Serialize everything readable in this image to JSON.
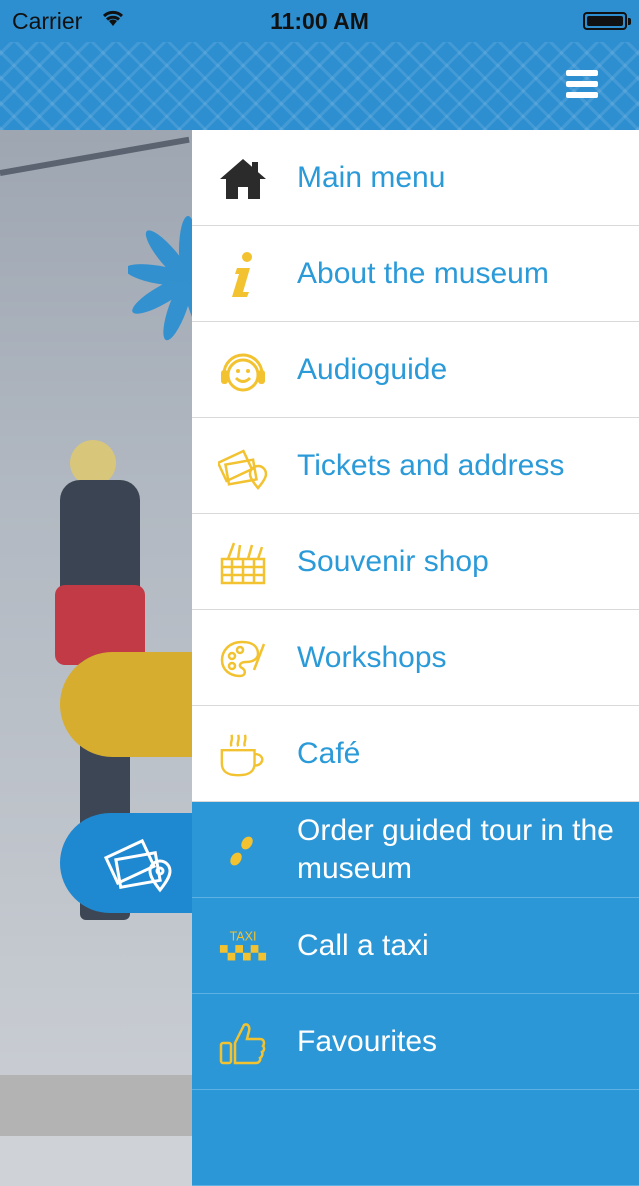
{
  "status_bar": {
    "carrier": "Carrier",
    "time": "11:00 AM"
  },
  "menu": {
    "items": [
      {
        "label": "Main menu",
        "icon": "home-icon"
      },
      {
        "label": "About the museum",
        "icon": "info-icon"
      },
      {
        "label": "Audioguide",
        "icon": "headphones-smiley-icon"
      },
      {
        "label": "Tickets and address",
        "icon": "tickets-location-icon"
      },
      {
        "label": "Souvenir shop",
        "icon": "basket-icon"
      },
      {
        "label": "Workshops",
        "icon": "palette-icon"
      },
      {
        "label": "Café",
        "icon": "coffee-cup-icon"
      },
      {
        "label": "Order guided tour in the museum",
        "icon": "footsteps-icon"
      },
      {
        "label": "Call a taxi",
        "icon": "taxi-icon",
        "badge": "TAXI"
      },
      {
        "label": "Favourites",
        "icon": "thumbs-up-icon"
      }
    ]
  },
  "colors": {
    "header_blue": "#2e8fd0",
    "drawer_highlight_blue": "#2c97d6",
    "label_blue": "#2a9ad8",
    "icon_yellow": "#f2c230"
  }
}
